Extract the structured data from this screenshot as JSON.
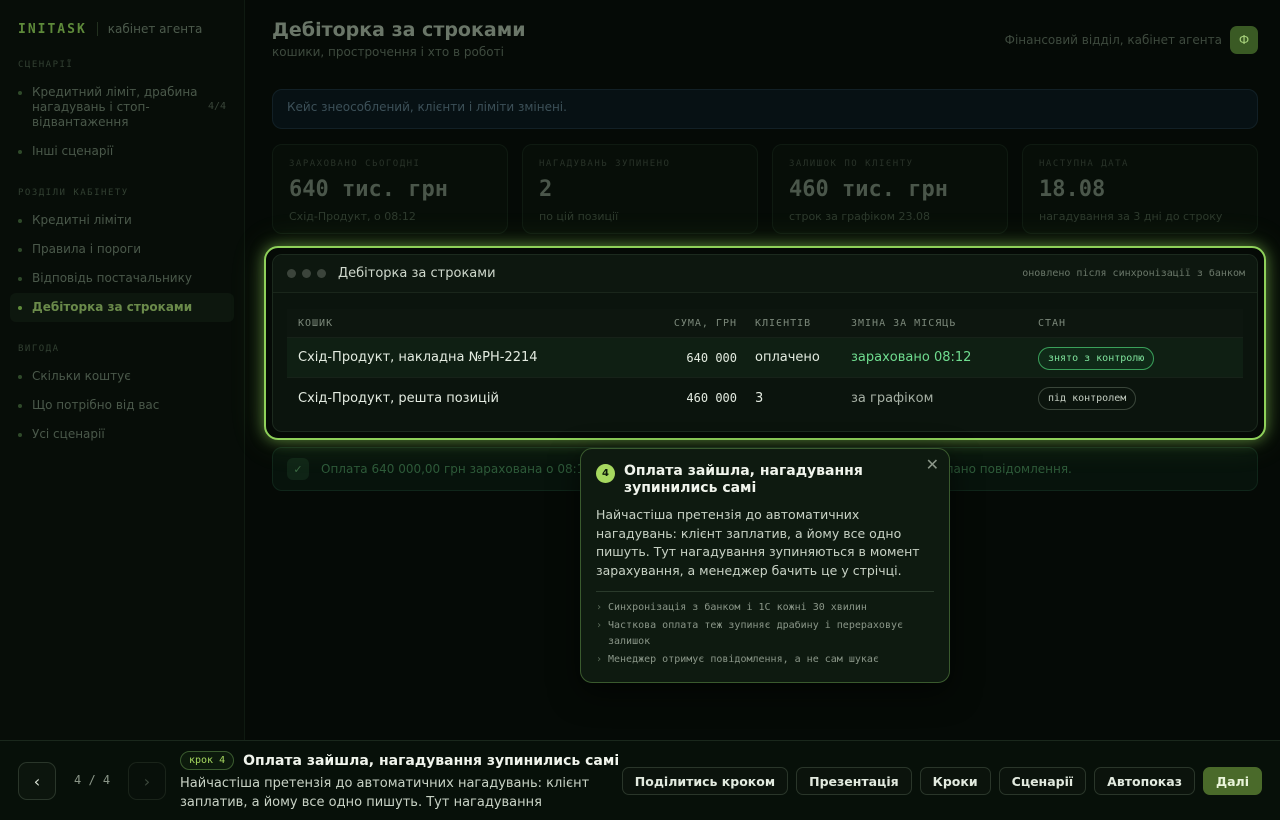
{
  "brand": {
    "logo": "INITASK",
    "subtitle": "кабінет агента"
  },
  "sidebar": {
    "sections": [
      {
        "title": "СЦЕНАРІЇ",
        "items": [
          {
            "label": "Кредитний ліміт, драбина нагадувань і стоп-відвантаження",
            "count": "4/4",
            "active": false
          },
          {
            "label": "Інші сценарії",
            "count": "",
            "active": false
          }
        ]
      },
      {
        "title": "РОЗДІЛИ КАБІНЕТУ",
        "items": [
          {
            "label": "Кредитні ліміти",
            "count": "",
            "active": false
          },
          {
            "label": "Правила і пороги",
            "count": "",
            "active": false
          },
          {
            "label": "Відповідь постачальнику",
            "count": "",
            "active": false
          },
          {
            "label": "Дебіторка за строками",
            "count": "",
            "active": true
          }
        ]
      },
      {
        "title": "ВИГОДА",
        "items": [
          {
            "label": "Скільки коштує",
            "count": "",
            "active": false
          },
          {
            "label": "Що потрібно від вас",
            "count": "",
            "active": false
          },
          {
            "label": "Усі сценарії",
            "count": "",
            "active": false
          }
        ]
      }
    ]
  },
  "header": {
    "title": "Дебіторка за строками",
    "subtitle": "кошики, прострочення і хто в роботі",
    "context": "Фінансовий відділ, кабінет агента",
    "badge": "Ф"
  },
  "alert": {
    "text": "Кейс знеособлений, клієнти і ліміти змінені."
  },
  "kpis": [
    {
      "label": "ЗАРАХОВАНО СЬОГОДНІ",
      "value": "640 тис. грн",
      "note": "Схід-Продукт, о 08:12"
    },
    {
      "label": "НАГАДУВАНЬ ЗУПИНЕНО",
      "value": "2",
      "note": "по цій позиції"
    },
    {
      "label": "ЗАЛИШОК ПО КЛІЄНТУ",
      "value": "460 тис. грн",
      "note": "строк за графіком 23.08"
    },
    {
      "label": "НАСТУПНА ДАТА",
      "value": "18.08",
      "note": "нагадування за 3 дні до строку"
    }
  ],
  "panel": {
    "title": "Дебіторка за строками",
    "meta": "оновлено після синхронізації з банком",
    "columns": [
      "КОШИК",
      "СУМА, ГРН",
      "КЛІЄНТІВ",
      "ЗМІНА ЗА МІСЯЦЬ",
      "СТАН"
    ],
    "rows": [
      {
        "basket": "Схід-Продукт, накладна №РН-2214",
        "amount": "640 000",
        "clients": "оплачено",
        "change": "зараховано 08:12",
        "status": "знято з контролю",
        "status_kind": "ok"
      },
      {
        "basket": "Схід-Продукт, решта позицій",
        "amount": "460 000",
        "clients": "3",
        "change": "за графіком",
        "status": "під контролем",
        "status_kind": "neutral"
      }
    ]
  },
  "confirmation": {
    "text": "Оплата 640 000,00 грн зарахована о 08:12, нагадування по накладній зупинені, менеджеру надіслано повідомлення."
  },
  "tooltip": {
    "step": "4",
    "title": "Оплата зайшла, нагадування зупинились самі",
    "body": "Найчастіша претензія до автоматичних нагадувань: клієнт заплатив, а йому все одно пишуть. Тут нагадування зупиняються в момент зарахування, а менеджер бачить це у стрічці.",
    "bullets": [
      "Синхронізація з банком і 1С кожні 30 хвилин",
      "Часткова оплата теж зупиняє драбину і перераховує залишок",
      "Менеджер отримує повідомлення, а не сам шукає"
    ],
    "close": "✕"
  },
  "bottom": {
    "prev": "‹",
    "next": "›",
    "counter": "4 / 4",
    "step_tag": "крок 4",
    "step_title": "Оплата зайшла, нагадування зупинились самі",
    "step_desc": "Найчастіша претензія до автоматичних нагадувань: клієнт заплатив, а йому все одно пишуть. Тут нагадування зупиняються в момент зарахування, а менеджер бачить це у стрічці.",
    "actions": [
      "Поділитись кроком",
      "Презентація",
      "Кроки",
      "Сценарії",
      "Автопоказ",
      "Далі"
    ]
  }
}
